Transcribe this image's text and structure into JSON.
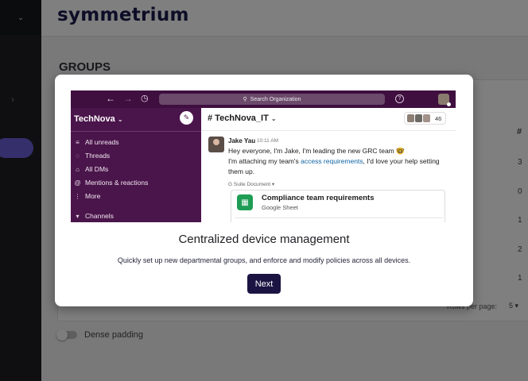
{
  "app": {
    "brand": "symmetrium"
  },
  "page": {
    "title": "GROUPS"
  },
  "table": {
    "column_header": "# ",
    "cells": [
      "3",
      "0",
      "1",
      "2",
      "1"
    ],
    "rows_per_page_label": "Rows per page:",
    "rows_per_page_value": "5 ▾"
  },
  "dense_padding": {
    "label": "Dense padding",
    "enabled": false
  },
  "modal": {
    "title": "Centralized device management",
    "description": "Quickly set up new departmental groups, and enforce and modify policies across all devices.",
    "next_label": "Next",
    "preview": {
      "search_placeholder": "Search Organization",
      "workspace": "TechNova",
      "sidebar_items": [
        {
          "icon": "unreads-icon",
          "glyph": "≡",
          "label": "All unreads"
        },
        {
          "icon": "threads-icon",
          "glyph": "◌",
          "label": "Threads"
        },
        {
          "icon": "dms-icon",
          "glyph": "⌂",
          "label": "All DMs"
        },
        {
          "icon": "mentions-icon",
          "glyph": "@",
          "label": "Mentions & reactions"
        },
        {
          "icon": "more-icon",
          "glyph": "⋮",
          "label": "More"
        },
        {
          "icon": "channels-caret-icon",
          "glyph": "▾",
          "label": "Channels"
        }
      ],
      "channel": "# TechNova_IT",
      "member_count": "46",
      "message": {
        "author": "Jake Yau",
        "time": "10:11 AM",
        "line1": "Hey everyone, I'm Jake, I'm leading the new GRC team 🤓",
        "line2_pre": "I'm attaching my team's ",
        "line2_link": "access requirements",
        "line2_post": ", I'd love your help setting",
        "line3": "them up."
      },
      "attachment": {
        "source": "G Suite Document ▾",
        "title": "Compliance team requirements",
        "subtitle": "Google Sheet"
      }
    }
  }
}
